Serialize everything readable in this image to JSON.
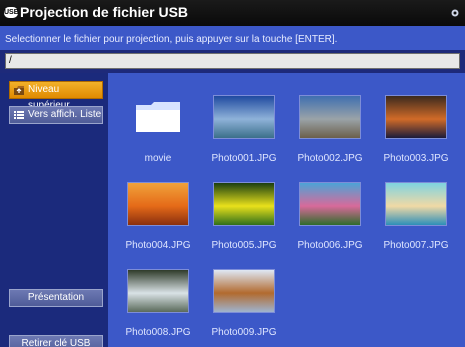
{
  "window": {
    "title": "Projection de fichier USB",
    "usb_badge": "USB",
    "instruction": "Selectionner le fichier pour projection, puis appuyer sur la touche [ENTER].",
    "path": "/"
  },
  "sidebar": {
    "up_button": "Niveau supérieur",
    "list_button": "Vers affich. Liste",
    "presentation_button": "Présentation",
    "remove_button": "Retirer clé USB"
  },
  "files": [
    {
      "name": "movie",
      "kind": "folder"
    },
    {
      "name": "Photo001.JPG",
      "kind": "image",
      "colors": [
        "#1f4aa0",
        "#8fb2d9",
        "#3b6f8a"
      ]
    },
    {
      "name": "Photo002.JPG",
      "kind": "image",
      "colors": [
        "#3f6fb0",
        "#9aa3a8",
        "#6b5f4b"
      ]
    },
    {
      "name": "Photo003.JPG",
      "kind": "image",
      "colors": [
        "#3b2a1e",
        "#d16b28",
        "#1b1b3a"
      ]
    },
    {
      "name": "Photo004.JPG",
      "kind": "image",
      "colors": [
        "#f0a23b",
        "#e56a18",
        "#8a2f0f"
      ]
    },
    {
      "name": "Photo005.JPG",
      "kind": "image",
      "colors": [
        "#1a3f10",
        "#e9e11b",
        "#2f6f1b"
      ]
    },
    {
      "name": "Photo006.JPG",
      "kind": "image",
      "colors": [
        "#4ca3d6",
        "#d86a9a",
        "#2f6c2a"
      ]
    },
    {
      "name": "Photo007.JPG",
      "kind": "image",
      "colors": [
        "#7fd3e0",
        "#f0d9a5",
        "#2d8fb8"
      ]
    },
    {
      "name": "Photo008.JPG",
      "kind": "image",
      "colors": [
        "#2f3b2a",
        "#d9e2e6",
        "#5a6a5a"
      ]
    },
    {
      "name": "Photo009.JPG",
      "kind": "image",
      "colors": [
        "#dfe8f5",
        "#b26a2e",
        "#9fb4cf"
      ]
    }
  ],
  "colors": {
    "accent_button": "#f3b12a",
    "panel_blue": "#3c58c8",
    "sidebar_blue": "#1b2a7c"
  }
}
